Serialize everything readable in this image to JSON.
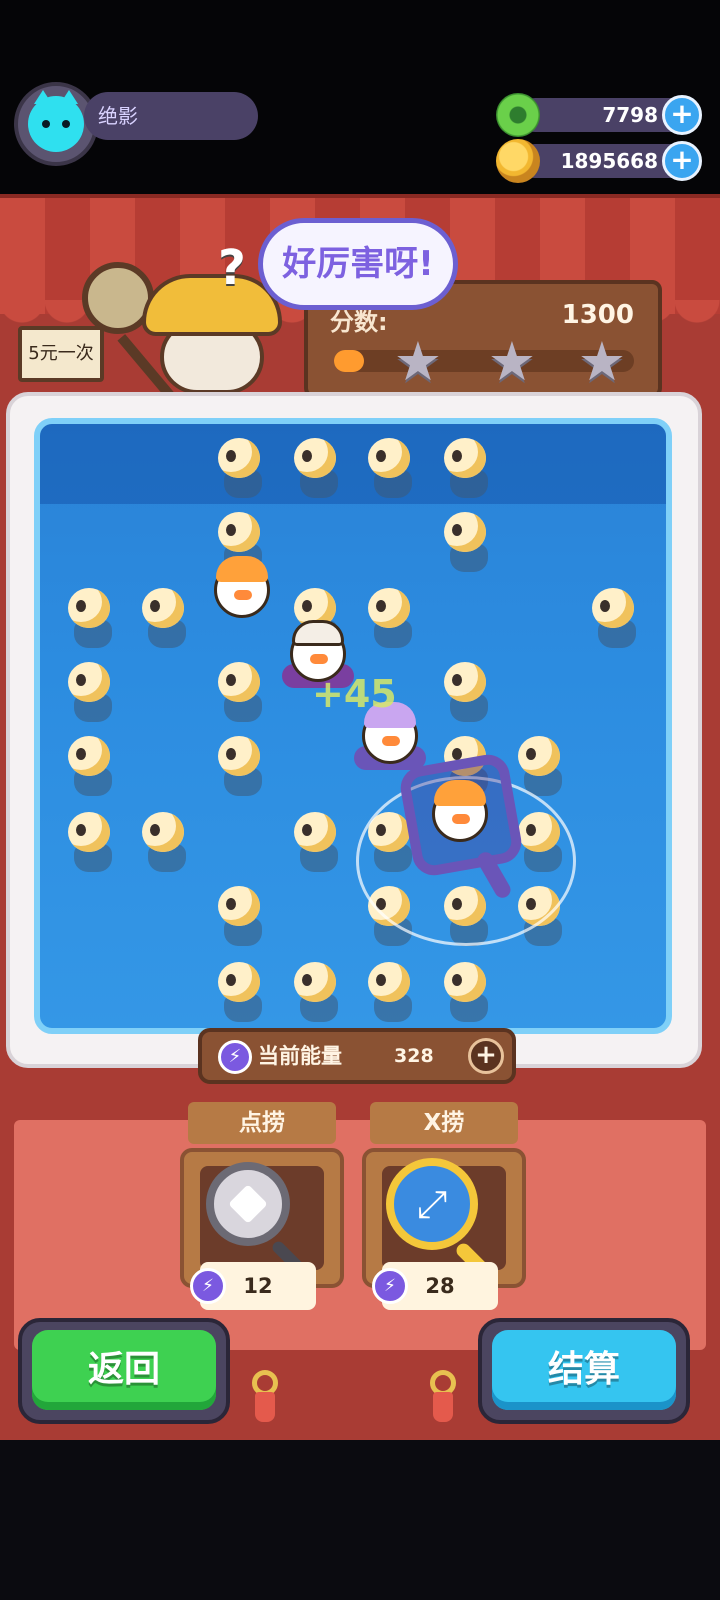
{
  "player": {
    "name": "绝影"
  },
  "currencies": [
    {
      "icon": "green-donut-icon",
      "value": "7798",
      "color": "#6ad04a"
    },
    {
      "icon": "gold-planet-icon",
      "value": "1895668",
      "color": "#f2b730"
    }
  ],
  "stall": {
    "sign": "5元一次"
  },
  "shopkeeper": {
    "speech": "好厉害呀!"
  },
  "score": {
    "label": "分数:",
    "value": "1300",
    "progress": 0.1,
    "stars_earned": 0,
    "stars_total": 3
  },
  "pond": {
    "score_popup": "+45"
  },
  "energy": {
    "label": "当前能量",
    "value": "328"
  },
  "tools": [
    {
      "name": "点捞",
      "cost": "12",
      "icon": "frying-pan-net-icon"
    },
    {
      "name": "X捞",
      "cost": "28",
      "icon": "expand-net-icon"
    }
  ],
  "buttons": {
    "back": "返回",
    "settle": "结算"
  },
  "colors": {
    "back_button": "#3ed151",
    "settle_button": "#35c5f0",
    "pond": "#2c8ce0",
    "energy": "#7b59e0"
  }
}
